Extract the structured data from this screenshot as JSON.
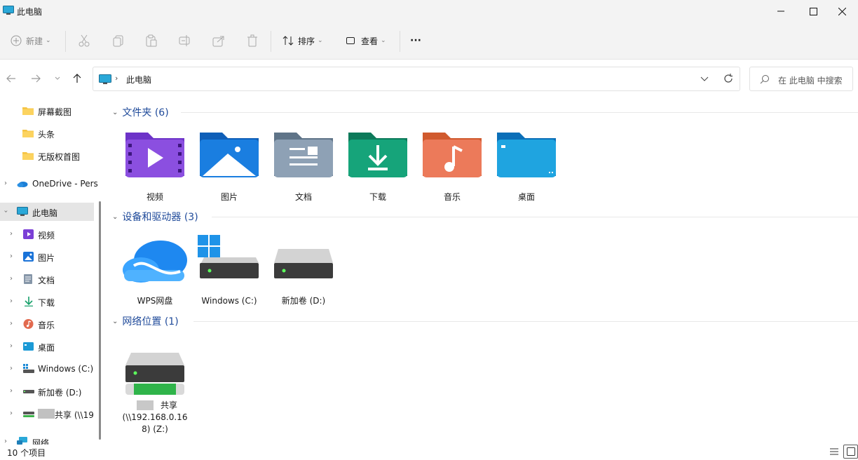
{
  "window": {
    "title": "此电脑"
  },
  "toolbar": {
    "new_label": "新建",
    "sort_label": "排序",
    "view_label": "查看",
    "more_label": "···"
  },
  "address": {
    "crumb": "此电脑",
    "search_placeholder": "在 此电脑 中搜索"
  },
  "sidebar": {
    "items": [
      {
        "label": "屏幕截图"
      },
      {
        "label": "头条"
      },
      {
        "label": "无版权首图"
      },
      {
        "label": "OneDrive - Pers"
      },
      {
        "label": "此电脑"
      },
      {
        "label": "视频"
      },
      {
        "label": "图片"
      },
      {
        "label": "文档"
      },
      {
        "label": "下载"
      },
      {
        "label": "音乐"
      },
      {
        "label": "桌面"
      },
      {
        "label": "Windows (C:)"
      },
      {
        "label": "新加卷 (D:)"
      },
      {
        "label": "共享 (\\\\19"
      },
      {
        "label": "网络"
      }
    ]
  },
  "sections": {
    "folders": {
      "title": "文件夹 (6)",
      "items": [
        {
          "label": "视频",
          "icon": "video-folder-icon"
        },
        {
          "label": "图片",
          "icon": "pictures-folder-icon"
        },
        {
          "label": "文档",
          "icon": "documents-folder-icon"
        },
        {
          "label": "下载",
          "icon": "downloads-folder-icon"
        },
        {
          "label": "音乐",
          "icon": "music-folder-icon"
        },
        {
          "label": "桌面",
          "icon": "desktop-folder-icon"
        }
      ]
    },
    "drives": {
      "title": "设备和驱动器 (3)",
      "items": [
        {
          "label": "WPS网盘"
        },
        {
          "label": "Windows (C:)"
        },
        {
          "label": "新加卷 (D:)"
        }
      ]
    },
    "network": {
      "title": "网络位置 (1)",
      "items": [
        {
          "line1": "共享",
          "line2": "(\\\\192.168.0.16",
          "line3": "8) (Z:)"
        }
      ]
    }
  },
  "status": {
    "count": "10 个项目"
  },
  "colors": {
    "accent": "#1f4a9a",
    "selected": "#e5e5e5",
    "chrome": "#f3f3f3"
  }
}
